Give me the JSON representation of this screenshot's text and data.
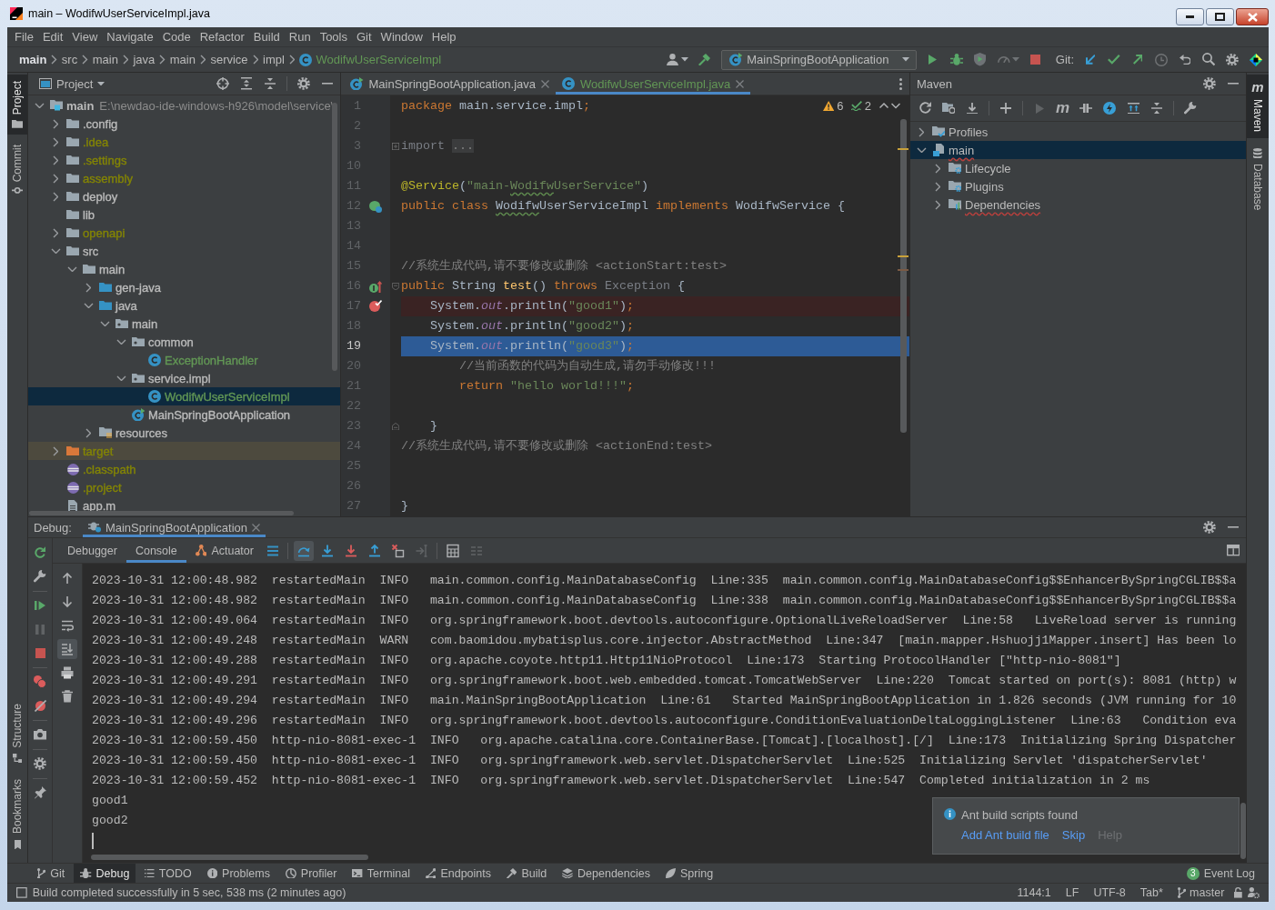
{
  "window": {
    "title": "main – WodifwUserServiceImpl.java"
  },
  "menu": [
    "File",
    "Edit",
    "View",
    "Navigate",
    "Code",
    "Refactor",
    "Build",
    "Run",
    "Tools",
    "Git",
    "Window",
    "Help"
  ],
  "breadcrumbs": [
    {
      "label": "main",
      "kind": "module",
      "color": "#dfe1e5"
    },
    {
      "label": "src",
      "kind": "folder",
      "color": "#bbbbbb"
    },
    {
      "label": "main",
      "kind": "folder",
      "color": "#bbbbbb"
    },
    {
      "label": "java",
      "kind": "folder",
      "color": "#bbbbbb"
    },
    {
      "label": "main",
      "kind": "folder",
      "color": "#bbbbbb"
    },
    {
      "label": "service",
      "kind": "folder",
      "color": "#bbbbbb"
    },
    {
      "label": "impl",
      "kind": "folder",
      "color": "#bbbbbb"
    },
    {
      "label": "WodifwUserServiceImpl",
      "kind": "class",
      "color": "#629755"
    }
  ],
  "toolbar": [
    {
      "kind": "user",
      "disabled": false
    },
    {
      "kind": "build",
      "disabled": false
    },
    {
      "kind": "run-config",
      "label": "MainSpringBootApplication",
      "disabled": false
    },
    {
      "kind": "run",
      "disabled": false
    },
    {
      "kind": "debug",
      "disabled": false
    },
    {
      "kind": "coverage",
      "disabled": false
    },
    {
      "kind": "profile",
      "disabled": true
    },
    {
      "kind": "stop",
      "disabled": false
    },
    {
      "kind": "vcs-label",
      "label": "Git:",
      "disabled": false
    },
    {
      "kind": "update",
      "disabled": false
    },
    {
      "kind": "commit",
      "disabled": false
    },
    {
      "kind": "push",
      "disabled": false
    },
    {
      "kind": "history",
      "disabled": true
    },
    {
      "kind": "rollback",
      "disabled": false
    },
    {
      "kind": "search",
      "disabled": false
    },
    {
      "kind": "settings",
      "disabled": false
    },
    {
      "kind": "toolbox",
      "disabled": false
    }
  ],
  "left_stripe": {
    "top": [
      {
        "label": "Project",
        "kind": "project",
        "selected": true
      },
      {
        "label": "Commit",
        "kind": "commit",
        "selected": false
      }
    ],
    "bottom": [
      {
        "label": "Structure",
        "kind": "structure",
        "selected": false
      },
      {
        "label": "Bookmarks",
        "kind": "bookmarks",
        "selected": false
      }
    ]
  },
  "project": {
    "title": "Project",
    "tree": [
      {
        "label": "main",
        "path": "E:\\newdao-ide-windows-h926\\model\\service\\",
        "kind": "module",
        "expanded": true,
        "selected": false,
        "color": "#bbbbbb",
        "children": [
          {
            "label": ".config",
            "kind": "folder",
            "expanded": false,
            "selected": false,
            "color": "#bbbbbb"
          },
          {
            "label": ".idea",
            "kind": "folder",
            "expanded": false,
            "selected": false,
            "color": "#848504"
          },
          {
            "label": ".settings",
            "kind": "folder",
            "expanded": false,
            "selected": false,
            "color": "#848504"
          },
          {
            "label": "assembly",
            "kind": "folder",
            "expanded": false,
            "selected": false,
            "color": "#848504"
          },
          {
            "label": "deploy",
            "kind": "folder",
            "expanded": false,
            "selected": false,
            "color": "#bbbbbb"
          },
          {
            "label": "lib",
            "kind": "folder",
            "selected": false,
            "color": "#bbbbbb"
          },
          {
            "label": "openapi",
            "kind": "folder",
            "expanded": false,
            "selected": false,
            "color": "#848504"
          },
          {
            "label": "src",
            "kind": "folder",
            "expanded": true,
            "selected": false,
            "color": "#bbbbbb",
            "children": [
              {
                "label": "main",
                "kind": "folder",
                "expanded": true,
                "selected": false,
                "color": "#bbbbbb",
                "children": [
                  {
                    "label": "gen-java",
                    "kind": "source-folder",
                    "expanded": false,
                    "selected": false,
                    "color": "#bbbbbb"
                  },
                  {
                    "label": "java",
                    "kind": "source-folder",
                    "expanded": true,
                    "selected": false,
                    "color": "#bbbbbb",
                    "children": [
                      {
                        "label": "main",
                        "kind": "package",
                        "expanded": true,
                        "selected": false,
                        "color": "#bbbbbb",
                        "children": [
                          {
                            "label": "common",
                            "kind": "package",
                            "expanded": true,
                            "selected": false,
                            "color": "#bbbbbb",
                            "children": [
                              {
                                "label": "ExceptionHandler",
                                "kind": "class",
                                "selected": false,
                                "color": "#629755"
                              }
                            ]
                          },
                          {
                            "label": "service.impl",
                            "kind": "package",
                            "expanded": true,
                            "selected": false,
                            "color": "#bbbbbb",
                            "children": [
                              {
                                "label": "WodifwUserServiceImpl",
                                "kind": "class",
                                "selected": true,
                                "color": "#629755"
                              }
                            ]
                          },
                          {
                            "label": "MainSpringBootApplication",
                            "kind": "app-class",
                            "selected": false,
                            "color": "#bbbbbb"
                          }
                        ]
                      }
                    ]
                  },
                  {
                    "label": "resources",
                    "kind": "resources-folder",
                    "expanded": false,
                    "selected": false,
                    "color": "#bbbbbb"
                  }
                ]
              }
            ]
          },
          {
            "label": "target",
            "kind": "excluded-folder",
            "expanded": false,
            "selected": false,
            "color": "#848504"
          },
          {
            "label": ".classpath",
            "kind": "eclipse-file",
            "selected": false,
            "color": "#848504"
          },
          {
            "label": ".project",
            "kind": "eclipse-file",
            "selected": false,
            "color": "#848504"
          },
          {
            "label": "app.m",
            "kind": "file",
            "selected": false,
            "color": "#bbbbbb"
          }
        ]
      }
    ]
  },
  "editor": {
    "tabs": [
      {
        "label": "MainSpringBootApplication.java",
        "kind": "app-class",
        "selected": false,
        "color": "#bbbbbb"
      },
      {
        "label": "WodifwUserServiceImpl.java",
        "kind": "class",
        "selected": true,
        "color": "#629755"
      }
    ],
    "inspections": {
      "warnings": "6",
      "weak_warnings": "2"
    },
    "lines": [
      {
        "number": "1",
        "breakpoint": false,
        "current": false,
        "tokens": [
          {
            "kind": "keyword",
            "text": "package"
          },
          {
            "kind": "plain",
            "text": " main.service.impl"
          },
          {
            "kind": "keyword",
            "text": ";"
          }
        ]
      },
      {
        "number": "2",
        "breakpoint": false,
        "current": false
      },
      {
        "number": "3",
        "breakpoint": false,
        "current": false,
        "fold_marker": {
          "kind": "collapsed"
        },
        "tokens": [
          {
            "kind": "unused",
            "text": "import "
          },
          {
            "kind": "folded",
            "text": "..."
          }
        ]
      },
      {
        "number": "10",
        "breakpoint": false,
        "current": false
      },
      {
        "number": "11",
        "breakpoint": false,
        "current": false,
        "tokens": [
          {
            "kind": "annotation",
            "text": "@Service"
          },
          {
            "kind": "plain",
            "text": "("
          },
          {
            "kind": "string",
            "text": "\"main-"
          },
          {
            "kind": "string-typo",
            "text": "Wodifw"
          },
          {
            "kind": "string",
            "text": "UserService\""
          },
          {
            "kind": "plain",
            "text": ")"
          }
        ]
      },
      {
        "number": "12",
        "breakpoint": false,
        "current": false,
        "gutter_icon": {
          "kind": "bean"
        },
        "tokens": [
          {
            "kind": "keyword",
            "text": "public class "
          },
          {
            "kind": "plain-typo",
            "text": "Wodifw"
          },
          {
            "kind": "plain",
            "text": "UserServiceImpl "
          },
          {
            "kind": "keyword",
            "text": "implements"
          },
          {
            "kind": "plain",
            "text": " WodifwService {"
          }
        ]
      },
      {
        "number": "13",
        "breakpoint": false,
        "current": false
      },
      {
        "number": "14",
        "breakpoint": false,
        "current": false
      },
      {
        "number": "15",
        "breakpoint": false,
        "current": false,
        "tokens": [
          {
            "kind": "comment",
            "text": "//系统生成代码,请不要修改或删除 <actionStart:test>"
          }
        ]
      },
      {
        "number": "16",
        "breakpoint": false,
        "current": false,
        "gutter_icon": {
          "kind": "implements"
        },
        "fold_marker": {
          "kind": "open"
        },
        "tokens": [
          {
            "kind": "keyword",
            "text": "public "
          },
          {
            "kind": "plain",
            "text": "String "
          },
          {
            "kind": "method",
            "text": "test"
          },
          {
            "kind": "plain",
            "text": "() "
          },
          {
            "kind": "keyword",
            "text": "throws "
          },
          {
            "kind": "unused",
            "text": "Exception"
          },
          {
            "kind": "plain",
            "text": " {"
          }
        ]
      },
      {
        "number": "17",
        "breakpoint": true,
        "current": false,
        "tokens": [
          {
            "kind": "plain",
            "text": "    System."
          },
          {
            "kind": "field",
            "text": "out"
          },
          {
            "kind": "plain",
            "text": ".println("
          },
          {
            "kind": "string",
            "text": "\"good1\""
          },
          {
            "kind": "plain",
            "text": ")"
          },
          {
            "kind": "keyword",
            "text": ";"
          }
        ]
      },
      {
        "number": "18",
        "breakpoint": false,
        "current": false,
        "tokens": [
          {
            "kind": "plain",
            "text": "    System."
          },
          {
            "kind": "field",
            "text": "out"
          },
          {
            "kind": "plain",
            "text": ".println("
          },
          {
            "kind": "string",
            "text": "\"good2\""
          },
          {
            "kind": "plain",
            "text": ")"
          },
          {
            "kind": "keyword",
            "text": ";"
          }
        ]
      },
      {
        "number": "19",
        "breakpoint": false,
        "current": true,
        "tokens": [
          {
            "kind": "plain",
            "text": "    System."
          },
          {
            "kind": "field",
            "text": "out"
          },
          {
            "kind": "plain",
            "text": ".println("
          },
          {
            "kind": "string",
            "text": "\"good3\""
          },
          {
            "kind": "plain",
            "text": ")"
          },
          {
            "kind": "keyword",
            "text": ";"
          }
        ]
      },
      {
        "number": "20",
        "breakpoint": false,
        "current": false,
        "tokens": [
          {
            "kind": "comment",
            "text": "        //当前函数的代码为自动生成,请勿手动修改!!!"
          }
        ]
      },
      {
        "number": "21",
        "breakpoint": false,
        "current": false,
        "tokens": [
          {
            "kind": "keyword",
            "text": "        return"
          },
          {
            "kind": "string",
            "text": " \"hello world!!!\""
          },
          {
            "kind": "keyword",
            "text": ";"
          }
        ]
      },
      {
        "number": "22",
        "breakpoint": false,
        "current": false
      },
      {
        "number": "23",
        "breakpoint": false,
        "current": false,
        "fold_marker": {
          "kind": "end"
        },
        "tokens": [
          {
            "kind": "plain",
            "text": "    }"
          }
        ]
      },
      {
        "number": "24",
        "breakpoint": false,
        "current": false,
        "tokens": [
          {
            "kind": "comment",
            "text": "//系统生成代码,请不要修改或删除 <actionEnd:test>"
          }
        ]
      },
      {
        "number": "25",
        "breakpoint": false,
        "current": false
      },
      {
        "number": "26",
        "breakpoint": false,
        "current": false
      },
      {
        "number": "27",
        "breakpoint": false,
        "current": false,
        "tokens": [
          {
            "kind": "plain",
            "text": "}"
          }
        ]
      }
    ]
  },
  "maven": {
    "title": "Maven",
    "toolbar": [
      {
        "kind": "reload",
        "disabled": false
      },
      {
        "kind": "add-project",
        "disabled": false
      },
      {
        "kind": "download",
        "disabled": false
      },
      {
        "kind": "add",
        "disabled": false
      },
      {
        "kind": "run",
        "disabled": true
      },
      {
        "kind": "goal",
        "glyph": "m",
        "disabled": false
      },
      {
        "kind": "offline",
        "disabled": false
      },
      {
        "kind": "skip-tests",
        "disabled": false
      },
      {
        "kind": "show-dependencies",
        "disabled": false
      },
      {
        "kind": "collapse",
        "disabled": false
      },
      {
        "kind": "settings",
        "disabled": false
      }
    ],
    "tree": [
      {
        "label": "Profiles",
        "kind": "profiles",
        "expanded": false,
        "selected": false,
        "problem": false
      },
      {
        "label": "main",
        "kind": "project",
        "expanded": true,
        "selected": true,
        "problem": true,
        "children": [
          {
            "label": "Lifecycle",
            "kind": "lifecycle",
            "expanded": false,
            "selected": false,
            "problem": false
          },
          {
            "label": "Plugins",
            "kind": "plugins",
            "expanded": false,
            "selected": false,
            "problem": false
          },
          {
            "label": "Dependencies",
            "kind": "dependencies",
            "expanded": false,
            "selected": false,
            "problem": true
          }
        ]
      }
    ]
  },
  "right_stripe": [
    {
      "label": "Maven",
      "kind": "maven",
      "glyph": "m",
      "selected": true
    },
    {
      "label": "Database",
      "kind": "database",
      "selected": false
    }
  ],
  "debug": {
    "title": "Debug:",
    "session": {
      "label": "MainSpringBootApplication",
      "selected": true
    },
    "side_toolbar": [
      {
        "kind": "rerun",
        "disabled": false
      },
      {
        "kind": "modify",
        "disabled": false
      },
      {
        "kind": "resume",
        "disabled": false
      },
      {
        "kind": "pause",
        "disabled": true
      },
      {
        "kind": "stop",
        "disabled": false
      },
      {
        "kind": "breakpoints",
        "disabled": false
      },
      {
        "kind": "mute-breakpoints",
        "disabled": false
      },
      {
        "kind": "snapshot",
        "disabled": false
      },
      {
        "kind": "settings",
        "disabled": false
      },
      {
        "kind": "pin",
        "disabled": false
      }
    ],
    "tabs": [
      {
        "label": "Debugger",
        "kind": "text",
        "selected": false
      },
      {
        "label": "Console",
        "kind": "text",
        "selected": true
      },
      {
        "label": "Actuator",
        "kind": "actuator",
        "selected": false
      }
    ],
    "toolbar": [
      {
        "kind": "execution-point",
        "hovered": false,
        "disabled": false
      },
      {
        "kind": "step-over",
        "hovered": true,
        "disabled": false
      },
      {
        "kind": "step-into",
        "hovered": false,
        "disabled": false
      },
      {
        "kind": "force-step-into",
        "hovered": false,
        "disabled": false
      },
      {
        "kind": "step-out",
        "hovered": false,
        "disabled": false
      },
      {
        "kind": "drop-frame",
        "hovered": false,
        "disabled": false
      },
      {
        "kind": "run-to-cursor",
        "hovered": false,
        "disabled": true
      },
      {
        "kind": "evaluate",
        "hovered": false,
        "disabled": false
      },
      {
        "kind": "trace",
        "hovered": false,
        "disabled": true
      }
    ],
    "console_toolbar": [
      {
        "kind": "up",
        "selected": false
      },
      {
        "kind": "down",
        "selected": false
      },
      {
        "kind": "soft-wrap",
        "selected": false
      },
      {
        "kind": "scroll-to-end",
        "selected": true
      },
      {
        "kind": "print",
        "selected": false
      },
      {
        "kind": "clear",
        "selected": false
      }
    ],
    "console": [
      "2023-10-31 12:00:48.982  restartedMain  INFO   main.common.config.MainDatabaseConfig  Line:335  main.common.config.MainDatabaseConfig$$EnhancerBySpringCGLIB$$a",
      "2023-10-31 12:00:48.982  restartedMain  INFO   main.common.config.MainDatabaseConfig  Line:338  main.common.config.MainDatabaseConfig$$EnhancerBySpringCGLIB$$a",
      "2023-10-31 12:00:49.064  restartedMain  INFO   org.springframework.boot.devtools.autoconfigure.OptionalLiveReloadServer  Line:58   LiveReload server is running",
      "2023-10-31 12:00:49.248  restartedMain  WARN   com.baomidou.mybatisplus.core.injector.AbstractMethod  Line:347  [main.mapper.Hshuojj1Mapper.insert] Has been lo",
      "2023-10-31 12:00:49.288  restartedMain  INFO   org.apache.coyote.http11.Http11NioProtocol  Line:173  Starting ProtocolHandler [\"http-nio-8081\"]",
      "2023-10-31 12:00:49.291  restartedMain  INFO   org.springframework.boot.web.embedded.tomcat.TomcatWebServer  Line:220  Tomcat started on port(s): 8081 (http) w",
      "2023-10-31 12:00:49.294  restartedMain  INFO   main.MainSpringBootApplication  Line:61   Started MainSpringBootApplication in 1.826 seconds (JVM running for 10",
      "2023-10-31 12:00:49.296  restartedMain  INFO   org.springframework.boot.devtools.autoconfigure.ConditionEvaluationDeltaLoggingListener  Line:63   Condition eva",
      "2023-10-31 12:00:59.450  http-nio-8081-exec-1  INFO   org.apache.catalina.core.ContainerBase.[Tomcat].[localhost].[/]  Line:173  Initializing Spring Dispatcher",
      "2023-10-31 12:00:59.450  http-nio-8081-exec-1  INFO   org.springframework.web.servlet.DispatcherServlet  Line:525  Initializing Servlet 'dispatcherServlet'",
      "2023-10-31 12:00:59.452  http-nio-8081-exec-1  INFO   org.springframework.web.servlet.DispatcherServlet  Line:547  Completed initialization in 2 ms",
      "good1",
      "good2"
    ],
    "notification": {
      "title": "Ant build scripts found",
      "actions": [
        {
          "label": "Add Ant build file",
          "disabled": false
        },
        {
          "label": "Skip",
          "disabled": false
        },
        {
          "label": "Help",
          "disabled": true
        }
      ]
    }
  },
  "tool_windows": [
    {
      "label": "Git",
      "kind": "git",
      "selected": false
    },
    {
      "label": "Debug",
      "kind": "debug",
      "selected": true
    },
    {
      "label": "TODO",
      "kind": "todo",
      "selected": false
    },
    {
      "label": "Problems",
      "kind": "problems",
      "selected": false
    },
    {
      "label": "Profiler",
      "kind": "profiler",
      "selected": false
    },
    {
      "label": "Terminal",
      "kind": "terminal",
      "selected": false
    },
    {
      "label": "Endpoints",
      "kind": "endpoints",
      "selected": false
    },
    {
      "label": "Build",
      "kind": "build",
      "selected": false
    },
    {
      "label": "Dependencies",
      "kind": "dependencies",
      "selected": false
    },
    {
      "label": "Spring",
      "kind": "spring",
      "selected": false
    }
  ],
  "event_log": {
    "label": "Event Log",
    "count": "3"
  },
  "status_bar": {
    "message": "Build completed successfully in 5 sec, 538 ms (2 minutes ago)",
    "position": "1144:1",
    "line_separator": "LF",
    "encoding": "UTF-8",
    "indent": "Tab*",
    "branch": "master"
  }
}
